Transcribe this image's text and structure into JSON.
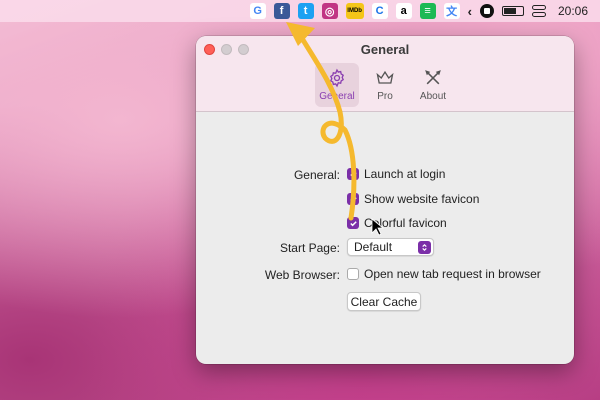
{
  "menubar": {
    "icons": [
      {
        "name": "google-icon",
        "glyph": "G",
        "color": "#ffffff",
        "fg": "#4285f4"
      },
      {
        "name": "facebook-icon",
        "glyph": "f",
        "color": "#3b5998",
        "fg": "#ffffff"
      },
      {
        "name": "twitter-icon",
        "glyph": "t",
        "color": "#1da1f2",
        "fg": "#ffffff"
      },
      {
        "name": "instagram-icon",
        "glyph": "◎",
        "color": "#c13584",
        "fg": "#ffffff"
      },
      {
        "name": "imdb-icon",
        "glyph": "IMDb",
        "color": "#f5c518",
        "fg": "#000000"
      },
      {
        "name": "c-icon",
        "glyph": "C",
        "color": "#ffffff",
        "fg": "#1a73e8"
      },
      {
        "name": "amazon-icon",
        "glyph": "a",
        "color": "#ffffff",
        "fg": "#000000"
      },
      {
        "name": "spotify-icon",
        "glyph": "≡",
        "color": "#1db954",
        "fg": "#ffffff"
      },
      {
        "name": "translate-icon",
        "glyph": "文",
        "color": "#ffffff",
        "fg": "#4285f4"
      }
    ],
    "clock": "20:06"
  },
  "window": {
    "title": "General",
    "tabs": [
      {
        "label": "General",
        "icon": "gear-icon"
      },
      {
        "label": "Pro",
        "icon": "crown-icon"
      },
      {
        "label": "About",
        "icon": "tools-icon"
      }
    ]
  },
  "settings": {
    "general_label": "General:",
    "launch_at_login": "Launch at login",
    "show_favicon": "Show website favicon",
    "colorful_favicon": "Colorful favicon",
    "start_page_label": "Start Page:",
    "start_page_value": "Default",
    "web_browser_label": "Web Browser:",
    "open_new_tab": "Open new tab request in browser",
    "clear_cache": "Clear Cache"
  },
  "colors": {
    "accent": "#7b2fa8",
    "annotation_arrow": "#f5b92e"
  }
}
